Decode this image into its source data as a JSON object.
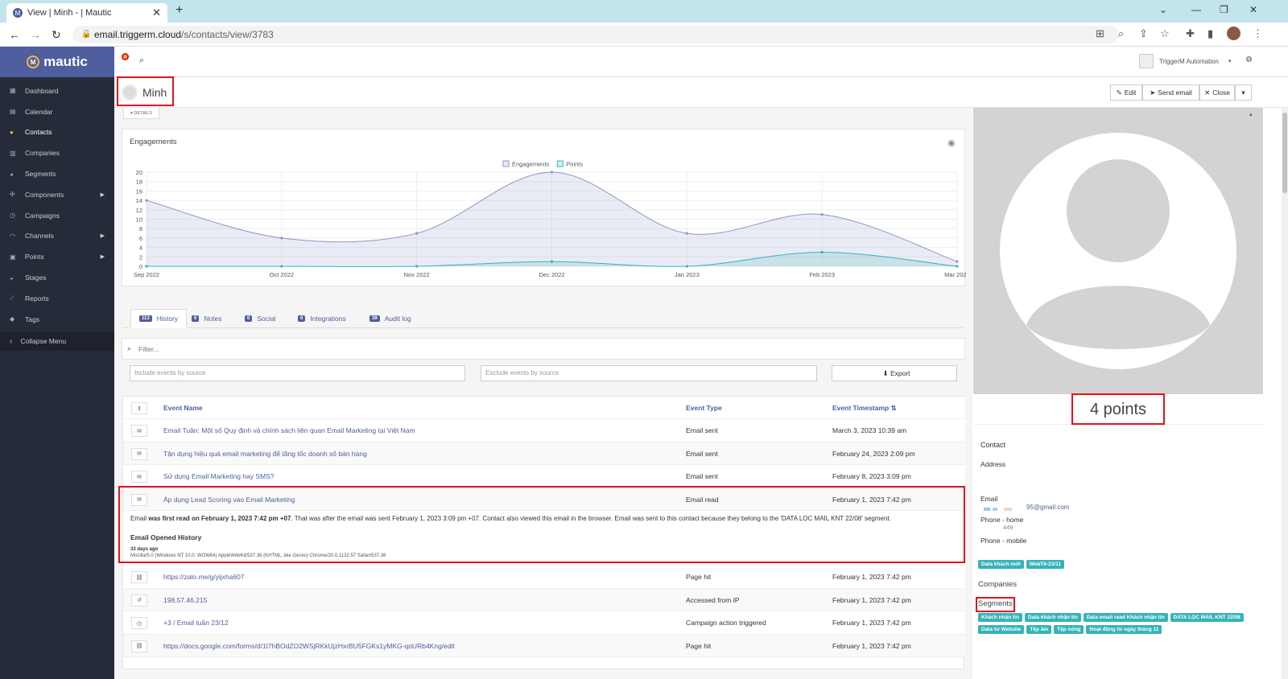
{
  "browser": {
    "tab_title": "View | Minh - | Mautic",
    "favicon": "mautic-favicon",
    "url_domain": "email.triggerm.cloud",
    "url_path": "/s/contacts/view/3783"
  },
  "sidebar": {
    "brand": "mautic",
    "items": [
      {
        "label": "Dashboard",
        "icon": "dashboard-icon",
        "active": false,
        "submenu": false
      },
      {
        "label": "Calendar",
        "icon": "calendar-icon",
        "active": false,
        "submenu": false
      },
      {
        "label": "Contacts",
        "icon": "user-icon",
        "active": true,
        "submenu": false
      },
      {
        "label": "Companies",
        "icon": "building-icon",
        "active": false,
        "submenu": false
      },
      {
        "label": "Segments",
        "icon": "pie-chart-icon",
        "active": false,
        "submenu": false
      },
      {
        "label": "Components",
        "icon": "puzzle-icon",
        "active": false,
        "submenu": true
      },
      {
        "label": "Campaigns",
        "icon": "clock-icon",
        "active": false,
        "submenu": false
      },
      {
        "label": "Channels",
        "icon": "rss-icon",
        "active": false,
        "submenu": true
      },
      {
        "label": "Points",
        "icon": "calculator-icon",
        "active": false,
        "submenu": true
      },
      {
        "label": "Stages",
        "icon": "tachometer-icon",
        "active": false,
        "submenu": false
      },
      {
        "label": "Reports",
        "icon": "line-chart-icon",
        "active": false,
        "submenu": false
      },
      {
        "label": "Tags",
        "icon": "tag-icon",
        "active": false,
        "submenu": false
      }
    ],
    "collapse_label": "Collapse Menu"
  },
  "topbar": {
    "user_name": "TriggerM Automation"
  },
  "header": {
    "contact_name": "Minh",
    "buttons": {
      "edit": "Edit",
      "send_email": "Send email",
      "close": "Close"
    }
  },
  "details_toggle": "DETAILS",
  "engagements": {
    "title": "Engagements",
    "chart_data": {
      "type": "area",
      "categories": [
        "Sep 2022",
        "Oct 2022",
        "Nov 2022",
        "Dec 2022",
        "Jan 2023",
        "Feb 2023",
        "Mar 2023"
      ],
      "series": [
        {
          "name": "Engagements",
          "values": [
            14,
            6,
            7,
            20,
            7,
            11,
            1
          ],
          "color": "#8d94c8"
        },
        {
          "name": "Points",
          "values": [
            0,
            0,
            0,
            1,
            0,
            3,
            0
          ],
          "color": "#35b4b9"
        }
      ],
      "y_ticks": [
        0,
        2,
        4,
        6,
        8,
        10,
        12,
        14,
        16,
        18,
        20
      ],
      "ylim": [
        0,
        20
      ],
      "grid": true,
      "legend_position": "top-center"
    }
  },
  "tabs": [
    {
      "count": "113",
      "label": "History",
      "active": true
    },
    {
      "count": "0",
      "label": "Notes",
      "active": false
    },
    {
      "count": "0",
      "label": "Social",
      "active": false
    },
    {
      "count": "0",
      "label": "Integrations",
      "active": false
    },
    {
      "count": "39",
      "label": "Audit log",
      "active": false
    }
  ],
  "filters": {
    "filter_placeholder": "Filter...",
    "include_placeholder": "Include events by source",
    "exclude_placeholder": "Exclude events by source",
    "export_label": "Export"
  },
  "table": {
    "columns": {
      "name": "Event Name",
      "type": "Event Type",
      "timestamp": "Event Timestamp"
    },
    "rows": [
      {
        "icon": "envelope-icon",
        "name": "Email Tuần: Một số Quy định và chính sách liên quan Email Marketing tại Việt Nam",
        "type": "Email sent",
        "time": "March 3, 2023 10:39 am"
      },
      {
        "icon": "envelope-icon",
        "name": "Tận dụng hiệu quả email marketing để tăng tốc doanh số bán hàng",
        "type": "Email sent",
        "time": "February 24, 2023 2:09 pm"
      },
      {
        "icon": "envelope-icon",
        "name": "Sử dụng Email Marketing hay SMS?",
        "type": "Email sent",
        "time": "February 8, 2023 3:09 pm"
      },
      {
        "icon": "envelope-open-icon",
        "name": "Áp dụng Lead Scoring vào Email Marketing",
        "type": "Email read",
        "time": "February 1, 2023 7:42 pm"
      }
    ],
    "expanded": {
      "prefix": "Email ",
      "bold": "was first read on February 1, 2023 7:42 pm +07",
      "rest": ". That was after the email was sent February 1, 2023 3:09 pm +07. Contact also viewed this email in the browser. Email was sent to this contact because they belong to the 'DATA LỌC MAIL KNT 22/08' segment.",
      "history_title": "Email Opened History",
      "ago": "33 days ago",
      "agent": "Mozilla/5.0 (Windows NT 10.0; WOW64) AppleWebKit/537.36 (KHTML, like Gecko) Chrome/20.0.1132.57 Safari/537.36"
    },
    "rows2": [
      {
        "icon": "link-icon",
        "name": "https://zalo.me/g/yijxha607",
        "type": "Page hit",
        "time": "February 1, 2023 7:42 pm"
      },
      {
        "icon": "history-icon",
        "name": "198.57.46.215",
        "type": "Accessed from IP",
        "time": "February 1, 2023 7:42 pm"
      },
      {
        "icon": "clock-icon",
        "name": "+3 / Email tuần 23/12",
        "type": "Campaign action triggered",
        "time": "February 1, 2023 7:42 pm"
      },
      {
        "icon": "link-icon",
        "name": "https://docs.google.com/forms/d/1I7hBOdZO2WSjRKkUjzHxrBU5FGKs1yMKG-qoURb4Kng/edit",
        "type": "Page hit",
        "time": "February 1, 2023 7:42 pm"
      }
    ]
  },
  "profile": {
    "points": "4 points",
    "contact_heading": "Contact",
    "address_label": "Address",
    "email_label": "Email",
    "email_value": "95@gmail.com",
    "phone_home_label": "Phone - home",
    "phone_home_value": "449",
    "phone_mobile_label": "Phone - mobile",
    "tags": [
      "Data khách mới",
      "WebT6-23/11"
    ],
    "companies_heading": "Companies",
    "segments_heading": "Segments",
    "segments": [
      "Khách nhận tin",
      "Data khách nhận tin",
      "Data email read Khách nhận tin",
      "DATA LỌC MAIL KNT 22/08",
      "Data từ Website",
      "Tệp ấm",
      "Tệp nóng",
      "Hoạt động từ ngày tháng 11"
    ]
  }
}
